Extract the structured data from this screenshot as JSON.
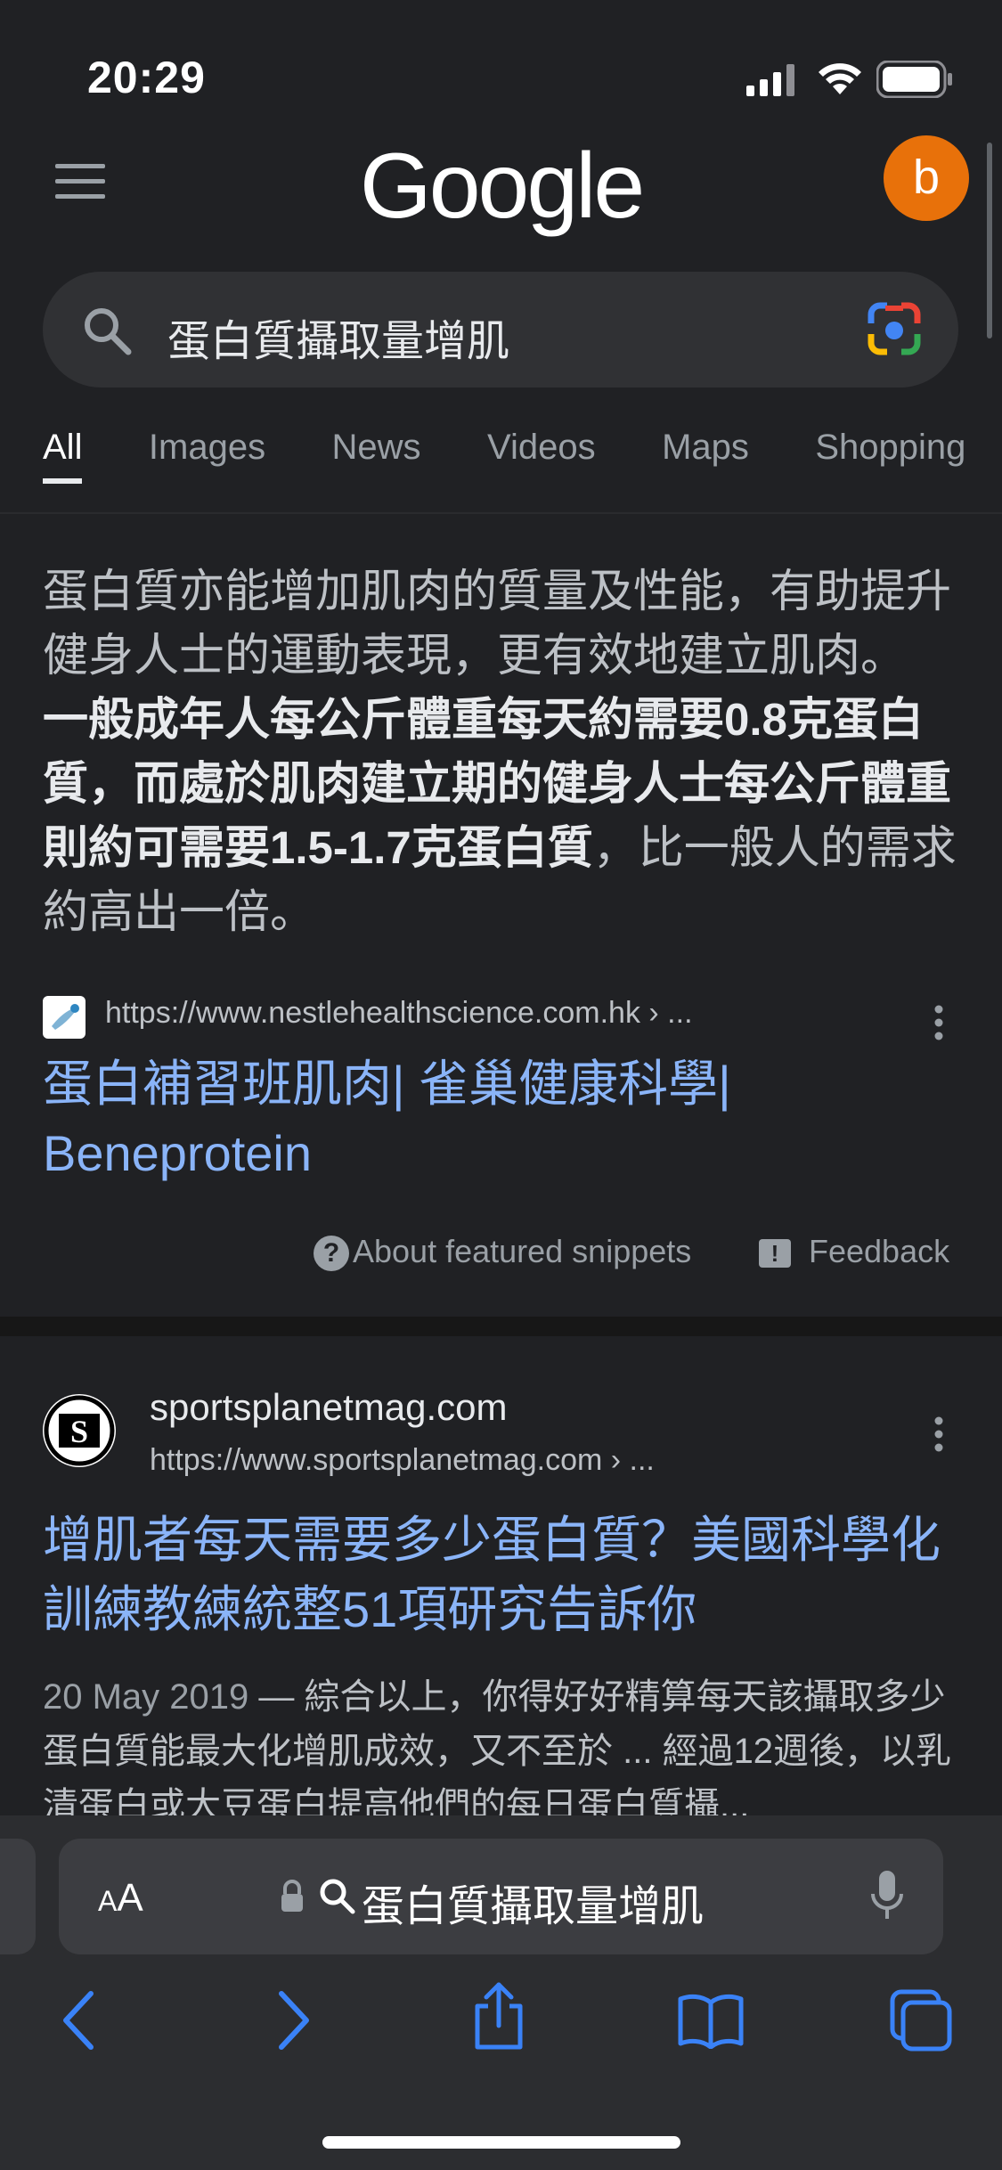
{
  "status": {
    "time": "20:29"
  },
  "header": {
    "logo": "Google",
    "avatar_letter": "b"
  },
  "search": {
    "query": "蛋白質攝取量增肌"
  },
  "tabs": [
    "All",
    "Images",
    "News",
    "Videos",
    "Maps",
    "Shopping"
  ],
  "snippet": {
    "text_normal_1": "蛋白質亦能增加肌肉的質量及性能，有助提升健身人士的運動表現，更有效地建立肌肉。 ",
    "text_bold": "一般成年人每公斤體重每天約需要0.8克蛋白質，而處於肌肉建立期的健身人士每公斤體重則約可需要1.5-1.7克蛋白質",
    "text_normal_2": "，比一般人的需求約高出一倍。",
    "source_url": "https://www.nestlehealthscience.com.hk › ...",
    "title": "蛋白補習班肌肉| 雀巢健康科學| Beneprotein",
    "about_label": "About featured snippets",
    "feedback_label": "Feedback"
  },
  "result2": {
    "favicon_letter": "S",
    "site": "sportsplanetmag.com",
    "url": "https://www.sportsplanetmag.com › ...",
    "title": "增肌者每天需要多少蛋白質？美國科學化訓練教練統整51項研究告訴你",
    "date": "20 May 2019",
    "description": " — 綜合以上，你得好好精算每天該攝取多少蛋白質能最大化增肌成效，又不至於 ... 經過12週後，以乳清蛋白或大豆蛋白提高他們的每日蛋白質攝..."
  },
  "safari": {
    "aa_label": "AA",
    "address_text": "蛋白質攝取量增肌"
  },
  "colors": {
    "background": "#202124",
    "link": "#8ab4f8",
    "avatar": "#e8710a",
    "safari_accent": "#3a82f7"
  }
}
